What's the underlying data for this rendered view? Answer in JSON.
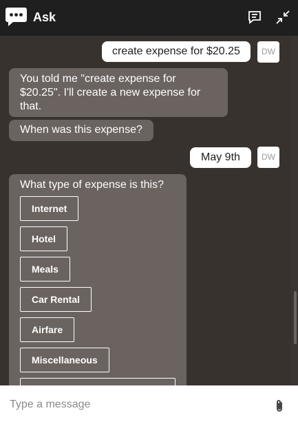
{
  "header": {
    "title": "Ask",
    "logo_icon": "chat-bubble-icon",
    "notes_icon": "notes-icon",
    "collapse_icon": "collapse-icon"
  },
  "messages": {
    "user1": {
      "text": "create expense for $20.25",
      "initials": "DW"
    },
    "bot1": {
      "text": "You told me \"create expense for $20.25\". I'll create a new expense for that."
    },
    "bot2": {
      "text": "When was this expense?"
    },
    "user2": {
      "text": "May 9th",
      "initials": "DW"
    },
    "bot3": {
      "text": "What type of expense is this?",
      "options": [
        "Internet",
        "Hotel",
        "Meals",
        "Car Rental",
        "Airfare",
        "Miscellaneous"
      ]
    }
  },
  "composer": {
    "placeholder": "Type a message",
    "attach_icon": "paperclip-icon"
  },
  "colors": {
    "header_bg": "#1f1f1f",
    "chat_bg": "#38322f",
    "bot_bubble": "#6a6360",
    "user_bubble": "#ffffff"
  }
}
